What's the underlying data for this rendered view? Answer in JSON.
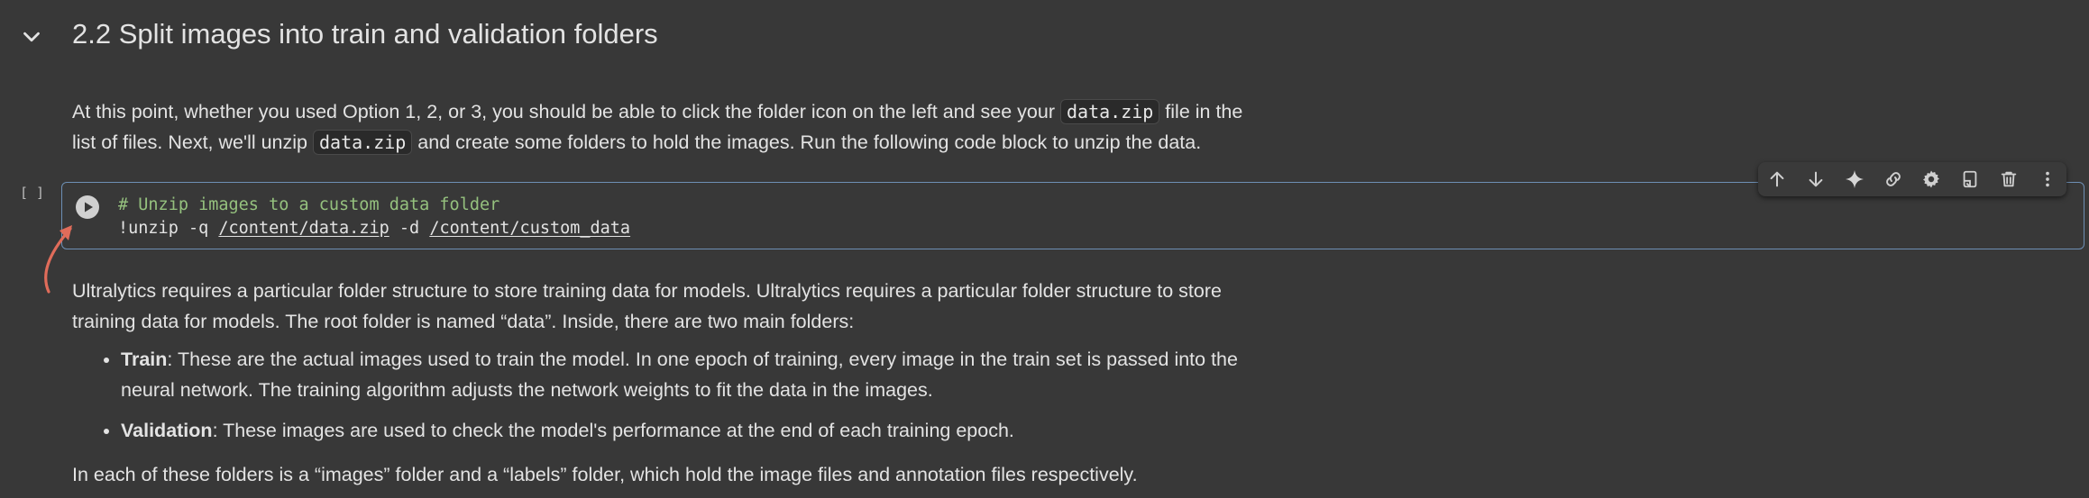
{
  "section": {
    "title": "2.2 Split images into train and validation folders"
  },
  "intro": {
    "line1_a": "At this point, whether you used Option 1, 2, or 3, you should be able to click the folder icon on the left and see your ",
    "line1_code": "data.zip",
    "line1_b": " file in the",
    "line2_a": "list of files. Next, we'll unzip ",
    "line2_code": "data.zip",
    "line2_b": " and create some folders to hold the images. Run the following code block to unzip the data."
  },
  "code_cell": {
    "execution_count": "[ ]",
    "comment": "# Unzip images to a custom data folder",
    "cmd_prefix": "!unzip -q ",
    "zip_path": "/content/data.zip",
    "cmd_mid": " -d ",
    "out_path": "/content/custom_data"
  },
  "toolbar": {
    "icons": [
      "arrow-up-icon",
      "arrow-down-icon",
      "sparkle-icon",
      "link-icon",
      "gear-icon",
      "mirror-cell-icon",
      "trash-icon",
      "more-vert-icon"
    ]
  },
  "body_text": {
    "para1_line1": "Ultralytics requires a particular folder structure to store training data for models. Ultralytics requires a particular folder structure to store",
    "para1_line2": "training data for models. The root folder is named “data”. Inside, there are two main folders:",
    "bullet1_bold": "Train",
    "bullet1_line1": ": These are the actual images used to train the model. In one epoch of training, every image in the train set is passed into the",
    "bullet1_line2": "neural network. The training algorithm adjusts the network weights to fit the data in the images.",
    "bullet2_bold": "Validation",
    "bullet2_text": ": These images are used to check the model's performance at the end of each training epoch.",
    "closing": "In each of these folders is a “images” folder and a “labels” folder, which hold the image files and annotation files respectively."
  },
  "colors": {
    "background": "#383838",
    "cell_border": "#6d8fb4",
    "comment": "#95c17e",
    "annotation_arrow": "#e06c5a"
  }
}
